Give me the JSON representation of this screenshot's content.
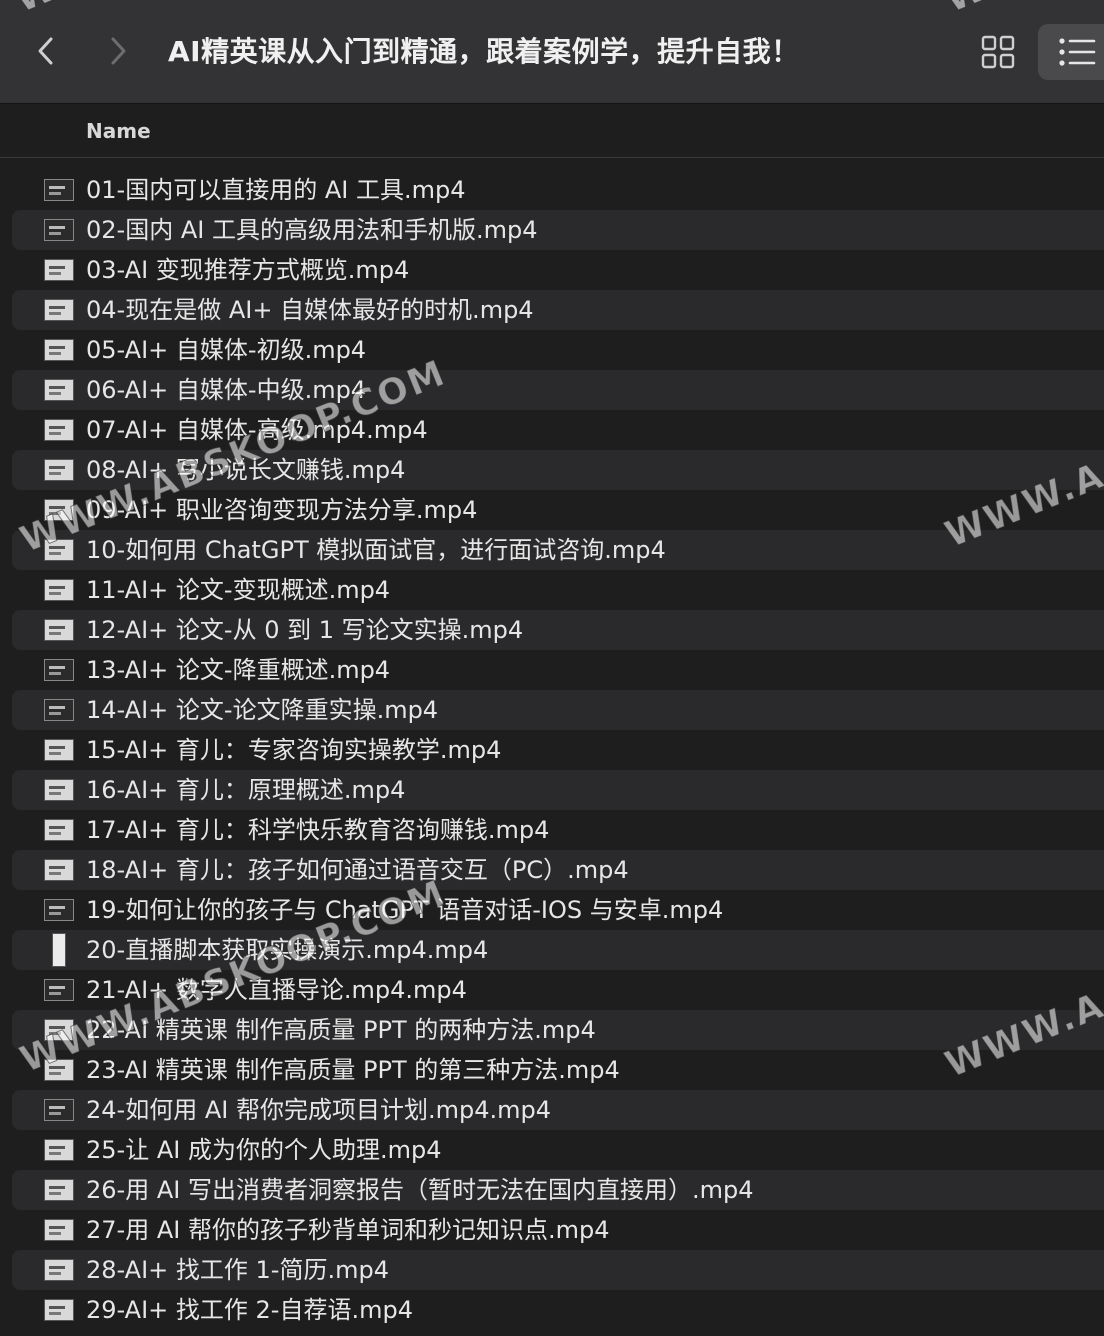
{
  "window": {
    "title": "AI精英课从入门到精通，跟着案例学，提升自我！"
  },
  "toolbar": {
    "back_icon": "chevron-left-icon",
    "forward_icon": "chevron-right-icon",
    "grid_view_icon": "grid-view-icon",
    "list_view_icon": "list-view-icon"
  },
  "columns": {
    "name": "Name"
  },
  "files": [
    "01-国内可以直接用的 AI 工具.mp4",
    "02-国内 AI 工具的高级用法和手机版.mp4",
    "03-AI 变现推荐方式概览.mp4",
    "04-现在是做 AI+ 自媒体最好的时机.mp4",
    "05-AI+ 自媒体-初级.mp4",
    "06-AI+ 自媒体-中级.mp4",
    "07-AI+ 自媒体-高级.mp4.mp4",
    "08-AI+ 写小说长文赚钱.mp4",
    "09-AI+ 职业咨询变现方法分享.mp4",
    "10-如何用 ChatGPT 模拟面试官，进行面试咨询.mp4",
    "11-AI+ 论文-变现概述.mp4",
    "12-AI+ 论文-从 0 到 1 写论文实操.mp4",
    "13-AI+ 论文-降重概述.mp4",
    "14-AI+ 论文-论文降重实操.mp4",
    "15-AI+ 育儿：专家咨询实操教学.mp4",
    "16-AI+ 育儿：原理概述.mp4",
    "17-AI+ 育儿：科学快乐教育咨询赚钱.mp4",
    "18-AI+ 育儿：孩子如何通过语音交互（PC）.mp4",
    "19-如何让你的孩子与 ChatGPT 语音对话-IOS 与安卓.mp4",
    "20-直播脚本获取实操演示.mp4.mp4",
    "21-AI+ 数字人直播导论.mp4.mp4",
    "22-AI 精英课 制作高质量 PPT 的两种方法.mp4",
    "23-AI 精英课 制作高质量 PPT 的第三种方法.mp4",
    "24-如何用 AI 帮你完成项目计划.mp4.mp4",
    "25-让 AI 成为你的个人助理.mp4",
    "26-用 AI 写出消费者洞察报告（暂时无法在国内直接用）.mp4",
    "27-用 AI 帮你的孩子秒背单词和秒记知识点.mp4",
    "28-AI+ 找工作 1-简历.mp4",
    "29-AI+ 找工作 2-自荐语.mp4"
  ],
  "watermarks": [
    "WWW.ABSKOOP.COM",
    "WWW.ABSKOOP.COM",
    "WWW.A",
    "WWW.A",
    "WWW.",
    "WWW."
  ]
}
